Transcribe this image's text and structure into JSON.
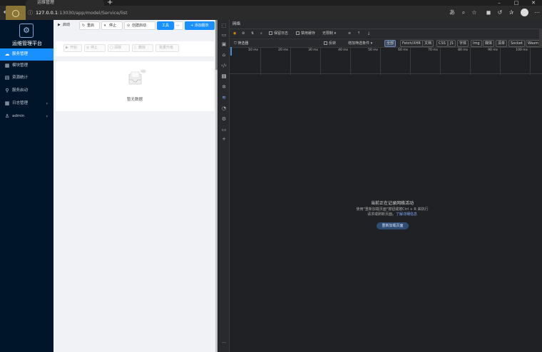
{
  "browser": {
    "tab_title": "运维管理",
    "url_host": "127.0.0.1",
    "url_path": ":13030/app/model/Service/list"
  },
  "sidebar": {
    "brand": "运维管理平台",
    "items": [
      {
        "label": "服务管理",
        "icon": "service-icon",
        "active": true,
        "has_children": false
      },
      {
        "label": "模块管理",
        "icon": "module-icon",
        "active": false,
        "has_children": false
      },
      {
        "label": "资源统计",
        "icon": "stats-icon",
        "active": false,
        "has_children": false
      },
      {
        "label": "服务启动",
        "icon": "launch-icon",
        "active": false,
        "has_children": false
      },
      {
        "label": "日志管理",
        "icon": "log-icon",
        "active": false,
        "has_children": true
      },
      {
        "label": "admin",
        "icon": "user-icon",
        "active": false,
        "has_children": true
      }
    ]
  },
  "toolbar": {
    "start": "启动",
    "restart": "重启",
    "stop": "停止",
    "create_start": "创建启动",
    "tools": "工具",
    "more": "···",
    "add_service": "+ 添加服务"
  },
  "actions": {
    "start": "开始",
    "stop": "停止",
    "clear": "清除",
    "delete": "删除",
    "batch": "批量升级"
  },
  "empty": {
    "text": "暂无数据"
  },
  "devtools": {
    "panel_title": "网络",
    "preserve_log": "保留日志",
    "disable_cache": "禁用缓存",
    "throttle": "无限制",
    "filter_placeholder": "筛选器",
    "invert": "反转",
    "more_filters": "增加筛选条件",
    "types": [
      "全部",
      "Fetch/XHR",
      "文档",
      "CSS",
      "JS",
      "字体",
      "Img",
      "媒体",
      "清单",
      "Socket",
      "Wasm"
    ],
    "timeline_ticks": [
      "10 ms",
      "20 ms",
      "30 ms",
      "40 ms",
      "50 ms",
      "60 ms",
      "70 ms",
      "80 ms",
      "90 ms",
      "100 ms"
    ],
    "recording_msg": "当前正在记录网络活动",
    "hint_line1": "使用\"重新加载页面\"按钮或按Ctrl + R 来执行",
    "hint_line2_prefix": "请求或刷新页面。",
    "hint_link": "了解详细信息",
    "reload_button": "重新加载页面",
    "more_menu": "···"
  }
}
